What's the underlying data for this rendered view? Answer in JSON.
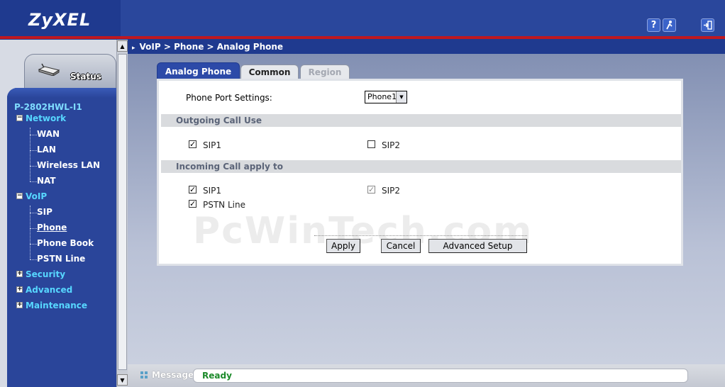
{
  "header": {
    "logo": "ZyXEL",
    "help_icon": "?",
    "wizard_icon": "wizard-icon",
    "logout_icon": "logout-icon",
    "colors": {
      "header_bg": "#1f3a8f",
      "accent_red": "#c01820"
    }
  },
  "sidebar": {
    "status_label": "Status",
    "model": "P-2802HWL-I1",
    "categories": {
      "network": {
        "label": "Network",
        "toggle": "−",
        "items": [
          "WAN",
          "LAN",
          "Wireless LAN",
          "NAT"
        ]
      },
      "voip": {
        "label": "VoIP",
        "toggle": "−",
        "items": [
          "SIP",
          "Phone",
          "Phone Book",
          "PSTN Line"
        ],
        "active": "Phone"
      },
      "security": {
        "label": "Security",
        "toggle": "+"
      },
      "advanced": {
        "label": "Advanced",
        "toggle": "+"
      },
      "maintenance": {
        "label": "Maintenance",
        "toggle": "+"
      }
    }
  },
  "content": {
    "breadcrumb": "VoIP > Phone > Analog Phone",
    "tabs": [
      {
        "label": "Analog Phone",
        "state": "active"
      },
      {
        "label": "Common",
        "state": "normal"
      },
      {
        "label": "Region",
        "state": "disabled"
      }
    ],
    "phone_port": {
      "label": "Phone Port Settings:",
      "selected": "Phone1"
    },
    "outgoing": {
      "heading": "Outgoing Call Use",
      "options": [
        {
          "label": "SIP1",
          "checked": true
        },
        {
          "label": "SIP2",
          "checked": false
        }
      ]
    },
    "incoming": {
      "heading": "Incoming Call apply to",
      "options": [
        {
          "label": "SIP1",
          "checked": true
        },
        {
          "label": "SIP2",
          "checked": true,
          "disabled": true
        },
        {
          "label": "PSTN Line",
          "checked": true
        }
      ]
    },
    "buttons": {
      "apply": "Apply",
      "cancel": "Cancel",
      "advanced_setup": "Advanced Setup"
    },
    "watermark": "PcWinTech.com"
  },
  "statusbar": {
    "label": "Message",
    "value": "Ready"
  }
}
